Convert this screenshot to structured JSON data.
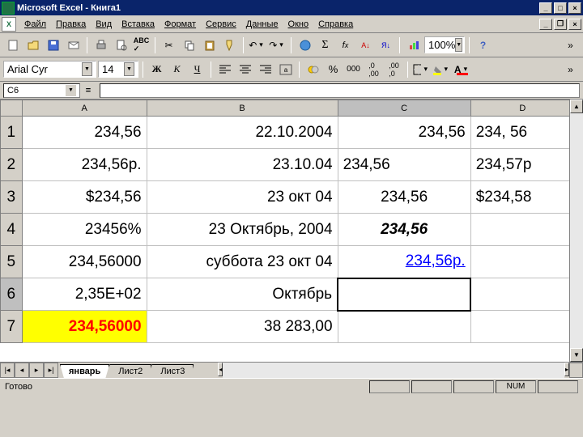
{
  "titlebar": {
    "title": "Microsoft Excel - Книга1"
  },
  "menu": {
    "file": "Файл",
    "edit": "Правка",
    "view": "Вид",
    "insert": "Вставка",
    "format": "Формат",
    "tools": "Сервис",
    "data": "Данные",
    "window": "Окно",
    "help": "Справка"
  },
  "toolbar": {
    "zoom": "100%"
  },
  "fmt": {
    "font": "Arial Cyr",
    "size": "14",
    "bold": "Ж",
    "italic": "К",
    "underline": "Ч"
  },
  "formula": {
    "namebox": "C6",
    "eq": "=",
    "value": ""
  },
  "cols": {
    "a": "A",
    "b": "B",
    "c": "C",
    "d": "D"
  },
  "rows": [
    "1",
    "2",
    "3",
    "4",
    "5",
    "6",
    "7"
  ],
  "cells": {
    "a1": "234,56",
    "b1": "22.10.2004",
    "c1": "234,56",
    "d1": "234, 56",
    "a2": "234,56р.",
    "b2": "23.10.04",
    "c2": "234,56",
    "d2": "234,57р",
    "a3": "$234,56",
    "b3": "23 окт 04",
    "c3": "234,56",
    "d3": "$234,58",
    "a4": "23456%",
    "b4": "23 Октябрь, 2004",
    "c4": "234,56",
    "d4": "",
    "a5": "234,56000",
    "b5": "суббота 23 окт 04",
    "c5": "234,56р.",
    "d5": "",
    "a6": "2,35E+02",
    "b6": "Октябрь",
    "c6": "",
    "d6": "",
    "a7": "234,56000",
    "b7": "38 283,00",
    "c7": "",
    "d7": ""
  },
  "tabs": {
    "t1": "январь",
    "t2": "Лист2",
    "t3": "Лист3"
  },
  "status": {
    "ready": "Готово",
    "num": "NUM"
  }
}
